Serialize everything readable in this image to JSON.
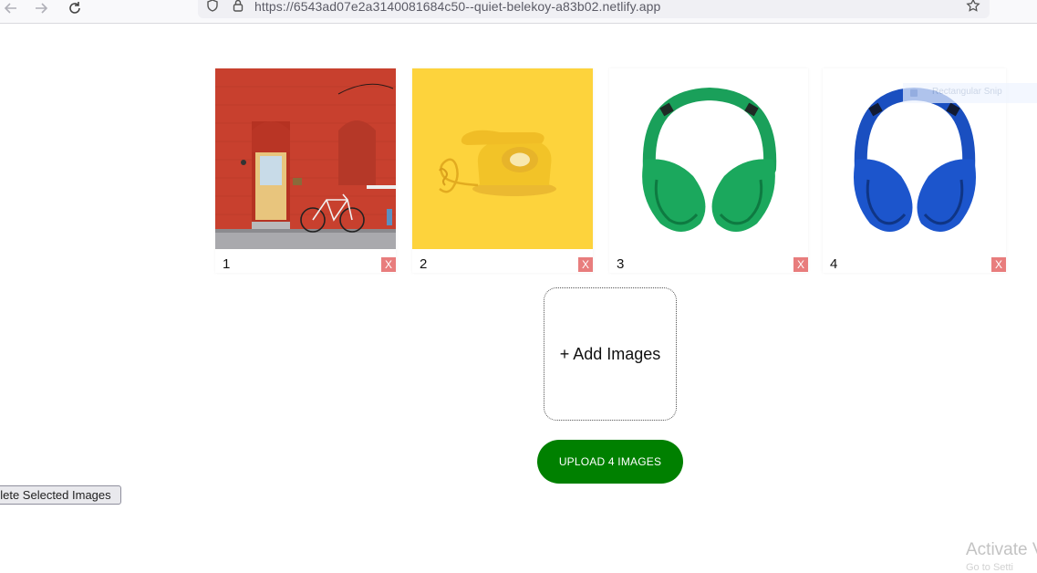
{
  "browser": {
    "url": "https://6543ad07e2a3140081684c50--quiet-belekoy-a83b02.netlify.app"
  },
  "gallery": {
    "images": [
      {
        "number": "1",
        "remove_label": "X",
        "subject": "red brick wall with door and bicycle"
      },
      {
        "number": "2",
        "remove_label": "X",
        "subject": "yellow rotary telephone"
      },
      {
        "number": "3",
        "remove_label": "X",
        "subject": "green headphones"
      },
      {
        "number": "4",
        "remove_label": "X",
        "subject": "blue headphones"
      }
    ]
  },
  "add_images": {
    "label": "+ Add Images"
  },
  "upload": {
    "label": "UPLOAD 4 IMAGES"
  },
  "delete_selected": {
    "label": "elete Selected Images"
  },
  "overlay": {
    "snip_label": "Rectangular Snip",
    "activate_label": "Activate V",
    "activate_sub": "Go to Setti"
  },
  "colors": {
    "upload_bg": "#008000",
    "remove_bg": "#e87d7d",
    "wall_red": "#c8402e",
    "phone_bg": "#fdd33c",
    "headphone_green": "#1aa05a",
    "headphone_blue": "#1a4fc0"
  }
}
